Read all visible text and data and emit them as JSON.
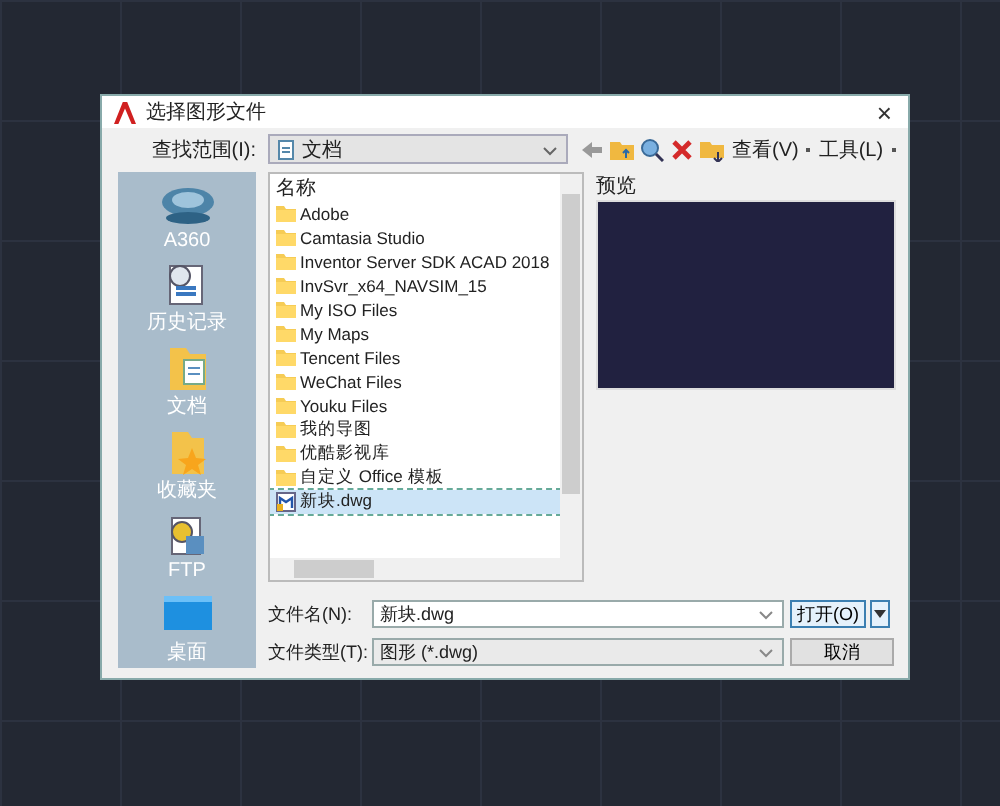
{
  "window": {
    "title": "选择图形文件",
    "close": "×"
  },
  "look_in": {
    "label": "查找范围(I):",
    "value": "文档"
  },
  "toolbar": {
    "view": "查看(V)",
    "tools": "工具(L)"
  },
  "sidebar": {
    "items": [
      {
        "kind": "cloud",
        "label": "A360"
      },
      {
        "kind": "history",
        "label": "历史记录"
      },
      {
        "kind": "documents",
        "label": "文档"
      },
      {
        "kind": "favorites",
        "label": "收藏夹"
      },
      {
        "kind": "ftp",
        "label": "FTP"
      },
      {
        "kind": "desktop",
        "label": "桌面"
      }
    ]
  },
  "files": {
    "header": "名称",
    "items": [
      {
        "kind": "folder",
        "name": "Adobe",
        "selected": false
      },
      {
        "kind": "folder",
        "name": "Camtasia Studio",
        "selected": false
      },
      {
        "kind": "folder",
        "name": "Inventor Server SDK ACAD 2018",
        "selected": false
      },
      {
        "kind": "folder",
        "name": "InvSvr_x64_NAVSIM_15",
        "selected": false
      },
      {
        "kind": "folder",
        "name": "My ISO Files",
        "selected": false
      },
      {
        "kind": "folder",
        "name": "My Maps",
        "selected": false
      },
      {
        "kind": "folder",
        "name": "Tencent Files",
        "selected": false
      },
      {
        "kind": "folder",
        "name": "WeChat Files",
        "selected": false
      },
      {
        "kind": "folder",
        "name": "Youku Files",
        "selected": false
      },
      {
        "kind": "folder",
        "name": "我的导图",
        "selected": false
      },
      {
        "kind": "folder",
        "name": "优酷影视库",
        "selected": false
      },
      {
        "kind": "folder",
        "name": "自定义 Office 模板",
        "selected": false
      },
      {
        "kind": "drawing",
        "name": "新块.dwg",
        "selected": true
      }
    ]
  },
  "preview": {
    "label": "预览"
  },
  "file_name": {
    "label": "文件名(N):",
    "value": "新块.dwg"
  },
  "file_type": {
    "label": "文件类型(T):",
    "value": "图形 (*.dwg)"
  },
  "buttons": {
    "open": "打开(O)",
    "cancel": "取消"
  }
}
